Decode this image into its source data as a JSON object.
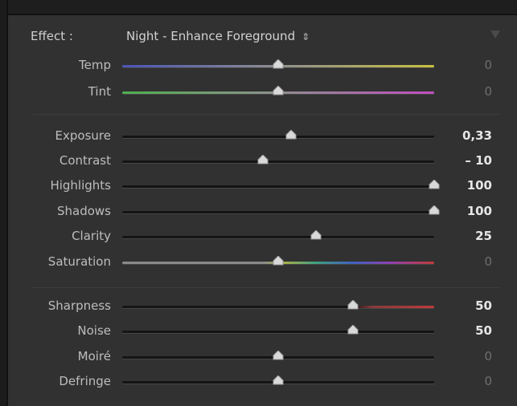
{
  "effect": {
    "label": "Effect :",
    "preset": "Night - Enhance Foreground",
    "preset_arrows": "⇕"
  },
  "colors": {
    "panel_bg": "#313131",
    "label_text": "#bdbdbd",
    "active_value": "#e6e6e6",
    "default_value": "#6e6e6e"
  },
  "sliders": [
    {
      "label": "Temp",
      "value": "0",
      "level": 0.5,
      "active": false,
      "track": "temp"
    },
    {
      "label": "Tint",
      "value": "0",
      "level": 0.5,
      "active": false,
      "track": "tint"
    },
    {
      "label": "Exposure",
      "value": "0,33",
      "level": 0.54,
      "active": true,
      "track": "dark"
    },
    {
      "label": "Contrast",
      "value": "– 10",
      "level": 0.45,
      "active": true,
      "track": "dark"
    },
    {
      "label": "Highlights",
      "value": "100",
      "level": 1.0,
      "active": true,
      "track": "dark"
    },
    {
      "label": "Shadows",
      "value": "100",
      "level": 1.0,
      "active": true,
      "track": "dark"
    },
    {
      "label": "Clarity",
      "value": "25",
      "level": 0.62,
      "active": true,
      "track": "dark"
    },
    {
      "label": "Saturation",
      "value": "0",
      "level": 0.5,
      "active": false,
      "track": "sat"
    },
    {
      "label": "Sharpness",
      "value": "50",
      "level": 0.74,
      "active": true,
      "track": "sharp"
    },
    {
      "label": "Noise",
      "value": "50",
      "level": 0.74,
      "active": true,
      "track": "dark"
    },
    {
      "label": "Moiré",
      "value": "0",
      "level": 0.5,
      "active": false,
      "track": "dark"
    },
    {
      "label": "Defringe",
      "value": "0",
      "level": 0.5,
      "active": false,
      "track": "dark"
    }
  ]
}
